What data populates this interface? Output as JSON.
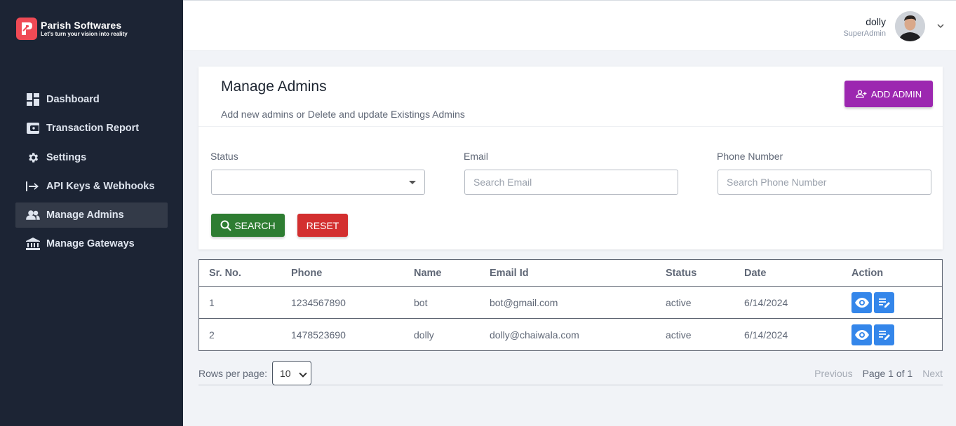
{
  "brand": {
    "name": "Parish Softwares",
    "tagline": "Let's turn your vision into reality"
  },
  "sidebar": {
    "items": [
      {
        "label": "Dashboard",
        "icon": "dashboard-icon"
      },
      {
        "label": "Transaction Report",
        "icon": "wallet-icon"
      },
      {
        "label": "Settings",
        "icon": "gear-icon"
      },
      {
        "label": "API Keys & Webhooks",
        "icon": "arrow-to-bar-icon"
      },
      {
        "label": "Manage Admins",
        "icon": "people-icon",
        "active": true
      },
      {
        "label": "Manage Gateways",
        "icon": "bank-icon"
      }
    ]
  },
  "header": {
    "user_name": "dolly",
    "user_role": "SuperAdmin"
  },
  "page": {
    "title": "Manage Admins",
    "subtitle": "Add new admins or Delete and update Existings Admins",
    "add_button": "ADD ADMIN"
  },
  "filters": {
    "status_label": "Status",
    "status_value": "",
    "email_label": "Email",
    "email_placeholder": "Search Email",
    "phone_label": "Phone Number",
    "phone_placeholder": "Search Phone Number",
    "search_button": "SEARCH",
    "reset_button": "RESET"
  },
  "table": {
    "headers": [
      "Sr. No.",
      "Phone",
      "Name",
      "Email Id",
      "Status",
      "Date",
      "Action"
    ],
    "rows": [
      {
        "sr": "1",
        "phone": "1234567890",
        "name": "bot",
        "email": "bot@gmail.com",
        "status": "active",
        "date": "6/14/2024"
      },
      {
        "sr": "2",
        "phone": "1478523690",
        "name": "dolly",
        "email": "dolly@chaiwala.com",
        "status": "active",
        "date": "6/14/2024"
      }
    ]
  },
  "pagination": {
    "rows_label": "Rows per page:",
    "rows_value": "10",
    "prev": "Previous",
    "page": "Page 1 of 1",
    "next": "Next"
  },
  "colors": {
    "sidebar": "#1c2434",
    "add_button": "#9c27b0",
    "search_button": "#2e7d32",
    "reset_button": "#d32f2f",
    "action_button": "#3486ea"
  }
}
